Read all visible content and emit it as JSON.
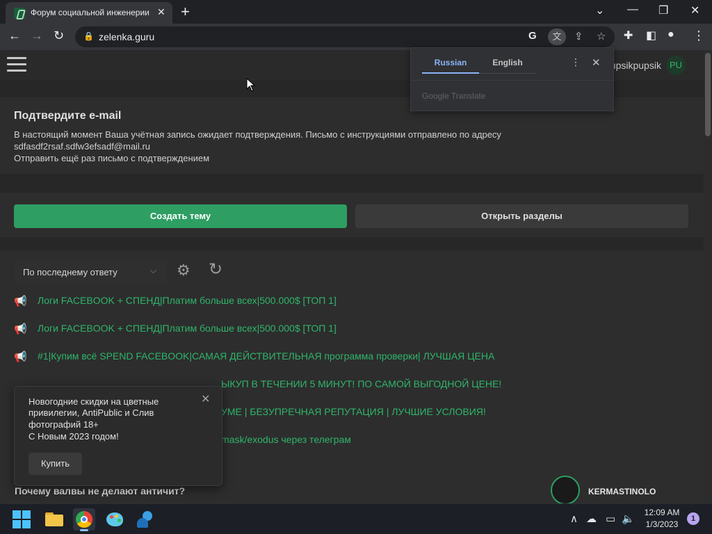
{
  "browser": {
    "tab_title": "Форум социальной инженерии",
    "tab_close": "✕",
    "new_tab": "+",
    "url": "zelenka.guru",
    "window_controls": {
      "minimize": "—",
      "maximize": "❐",
      "close": "✕",
      "tab_search": "⌄"
    }
  },
  "translate_popup": {
    "tab_source": "Russian",
    "tab_target": "English",
    "brand": "Google Translate"
  },
  "site_header": {
    "username": "pupsikpupsik",
    "avatar_initials": "PU"
  },
  "email_notice": {
    "title": "Подтвердите e-mail",
    "line1": "В настоящий момент Ваша учётная запись ожидает подтверждения. Письмо с инструкциями отправлено по адресу",
    "email": "sdfasdf2rsaf.sdfw3efsadf@mail.ru",
    "resend": "Отправить ещё раз письмо с подтверждением"
  },
  "actions": {
    "create_topic": "Создать тему",
    "open_sections": "Открыть разделы"
  },
  "thread_list": {
    "sort_label": "По последнему ответу",
    "threads": [
      {
        "title": "Логи FACEBOOK + СПЕНД|Платим больше всех|500.000$ [ТОП 1]"
      },
      {
        "title": "Логи FACEBOOK + СПЕНД|Платим больше всех|500.000$ [ТОП 1]"
      },
      {
        "title": "#1|Купим всё SPEND FACEBOOK|САМАЯ ДЕЙСТВИТЕЛЬНАЯ программа проверки| ЛУЧШАЯ ЦЕНА"
      },
      {
        "title": "ЫКУП В ТЕЧЕНИИ 5 МИНУТ! ПО САМОЙ ВЫГОДНОЙ ЦЕНЕ!"
      },
      {
        "title": "УМЕ | БЕЗУПРЕЧНАЯ РЕПУТАЦИЯ | ЛУЧШИЕ УСЛОВИЯ!"
      },
      {
        "title": "mask/exodus через телеграм"
      }
    ],
    "plain_thread": "Почему валвы не делают античит?",
    "plain_thread_author": "KERMASTINOLO"
  },
  "promo": {
    "line1": "Новогодние скидки на цветные",
    "line2": "привилегии, AntiPublic и Слив",
    "line3": "фотографий 18+",
    "line4": "С Новым 2023 годом!",
    "buy": "Купить",
    "close": "✕"
  },
  "taskbar": {
    "time": "12:09 AM",
    "date": "1/3/2023",
    "notifications": "1"
  },
  "colors": {
    "accent_green": "#2e9e63",
    "link_green": "#2fb56a",
    "translate_blue": "#8ab4f8"
  }
}
